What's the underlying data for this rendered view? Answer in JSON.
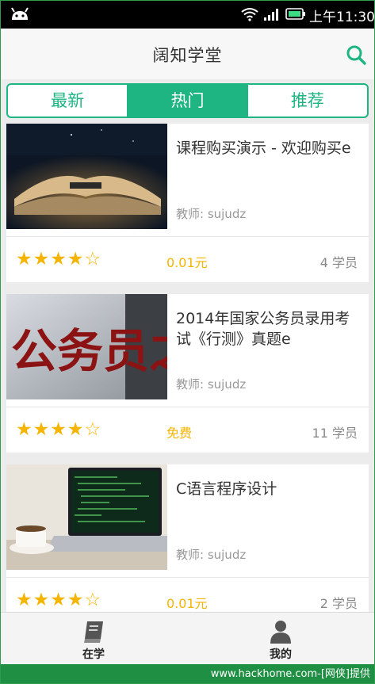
{
  "status_bar": {
    "time": "上午11:30"
  },
  "header": {
    "title": "阔知学堂"
  },
  "tabs": [
    {
      "label": "最新",
      "active": false
    },
    {
      "label": "热门",
      "active": true
    },
    {
      "label": "推荐",
      "active": false
    }
  ],
  "courses": [
    {
      "title": "课程购买演示 - 欢迎购买e",
      "teacher": "教师: sujudz",
      "stars": "★★★★☆",
      "rating": 4,
      "price": "0.01元",
      "students": "4 学员"
    },
    {
      "title": "2014年国家公务员录用考试《行测》真题e",
      "teacher": "教师: sujudz",
      "stars": "★★★★☆",
      "rating": 3.5,
      "price": "免费",
      "students": "11 学员",
      "thumb_text": "公务员之"
    },
    {
      "title": "C语言程序设计",
      "teacher": "教师: sujudz",
      "stars": "★★★★☆",
      "rating": 4,
      "price": "0.01元",
      "students": "2 学员"
    }
  ],
  "bottom_nav": [
    {
      "label": "在学",
      "icon": "book-icon"
    },
    {
      "label": "我的",
      "icon": "user-icon"
    }
  ],
  "watermark": "www.hackhome.com-[网侠]提供",
  "colors": {
    "accent": "#1fb582",
    "star": "#f5b400",
    "status_bar": "#000000"
  }
}
